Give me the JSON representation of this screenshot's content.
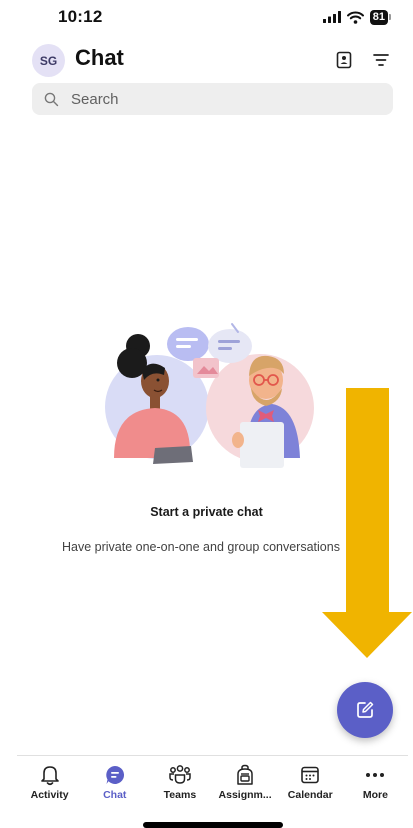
{
  "status_bar": {
    "time": "10:12",
    "battery": "81"
  },
  "header": {
    "avatar_initials": "SG",
    "title": "Chat",
    "icons": [
      "contact-card-icon",
      "filter-icon"
    ]
  },
  "search": {
    "placeholder": "Search"
  },
  "empty_state": {
    "title": "Start a private chat",
    "subtitle": "Have private one-on-one and group conversations"
  },
  "fab": {
    "icon": "compose-icon"
  },
  "nav": {
    "items": [
      {
        "label": "Activity",
        "icon": "bell-icon"
      },
      {
        "label": "Chat",
        "icon": "chat-icon",
        "active": true
      },
      {
        "label": "Teams",
        "icon": "teams-icon"
      },
      {
        "label": "Assignm...",
        "icon": "backpack-icon"
      },
      {
        "label": "Calendar",
        "icon": "calendar-icon"
      },
      {
        "label": "More",
        "icon": "more-icon"
      }
    ]
  },
  "colors": {
    "accent": "#5b5fc7",
    "arrow": "#F0B400"
  }
}
